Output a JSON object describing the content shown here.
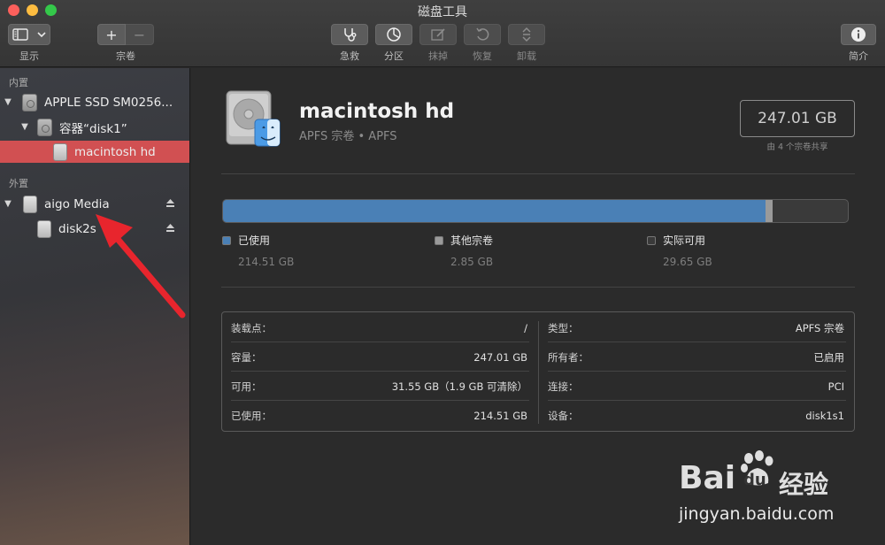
{
  "window": {
    "title": "磁盘工具"
  },
  "toolbar": {
    "view_label": "显示",
    "volume_label": "宗卷",
    "firstaid_label": "急救",
    "partition_label": "分区",
    "erase_label": "抹掉",
    "restore_label": "恢复",
    "unmount_label": "卸载",
    "info_label": "简介",
    "add_glyph": "+",
    "remove_glyph": "−"
  },
  "sidebar": {
    "internal_header": "内置",
    "external_header": "外置",
    "items": [
      {
        "label": "APPLE SSD SM0256..."
      },
      {
        "label": "容器“disk1”"
      },
      {
        "label": "macintosh hd"
      },
      {
        "label": "aigo Media"
      },
      {
        "label": "disk2s"
      }
    ]
  },
  "volume": {
    "name": "macintosh hd",
    "subtitle": "APFS 宗卷 • APFS",
    "capacity": "247.01 GB",
    "shared_note": "由 4 个宗卷共享"
  },
  "usage": {
    "used_fraction": 0.868,
    "other_fraction": 0.0115,
    "legend": [
      {
        "label": "已使用",
        "value": "214.51 GB",
        "color": "#4a80b6"
      },
      {
        "label": "其他宗卷",
        "value": "2.85 GB",
        "color": "#9a9a9a"
      },
      {
        "label": "实际可用",
        "value": "29.65 GB",
        "color": "#3a3a3a"
      }
    ]
  },
  "info": {
    "left": [
      {
        "key": "装载点：",
        "value": "/"
      },
      {
        "key": "容量：",
        "value": "247.01 GB"
      },
      {
        "key": "可用：",
        "value": "31.55 GB（1.9 GB 可清除）"
      },
      {
        "key": "已使用：",
        "value": "214.51 GB"
      }
    ],
    "right": [
      {
        "key": "类型：",
        "value": "APFS 宗卷"
      },
      {
        "key": "所有者：",
        "value": "已启用"
      },
      {
        "key": "连接：",
        "value": "PCI"
      },
      {
        "key": "设备：",
        "value": "disk1s1"
      }
    ]
  },
  "watermark": {
    "brand_a": "Bai",
    "brand_b": "du",
    "brand_c": "经验",
    "url": "jingyan.baidu.com"
  },
  "colors": {
    "selected_row": "#d15052",
    "used_bar": "#4a80b6",
    "annotation_arrow": "#e8252d"
  }
}
